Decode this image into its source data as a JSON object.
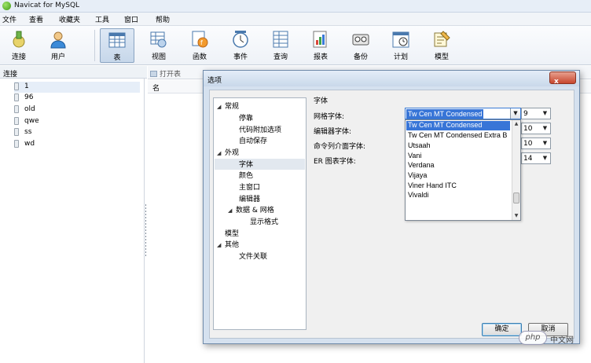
{
  "window": {
    "title": "Navicat for MySQL"
  },
  "menu": [
    "文件",
    "查看",
    "收藏夹",
    "工具",
    "窗口",
    "帮助"
  ],
  "toolbar": {
    "items": [
      {
        "label": "连接",
        "icon": "connection-icon"
      },
      {
        "label": "用户",
        "icon": "user-icon"
      },
      {
        "label": "表",
        "icon": "table-icon",
        "active": true
      },
      {
        "label": "视图",
        "icon": "view-icon"
      },
      {
        "label": "函数",
        "icon": "function-icon"
      },
      {
        "label": "事件",
        "icon": "event-icon"
      },
      {
        "label": "查询",
        "icon": "query-icon"
      },
      {
        "label": "报表",
        "icon": "report-icon"
      },
      {
        "label": "备份",
        "icon": "backup-icon"
      },
      {
        "label": "计划",
        "icon": "schedule-icon"
      },
      {
        "label": "模型",
        "icon": "model-icon"
      }
    ]
  },
  "left_pane": {
    "header": "连接",
    "databases": [
      "1",
      "96",
      "old",
      "qwe",
      "ss",
      "wd"
    ]
  },
  "object_pane": {
    "open_table": "打开表",
    "column_name": "名"
  },
  "dialog": {
    "title": "选项",
    "close": "x",
    "tree": [
      {
        "label": "常规",
        "level": 0,
        "expanded": true
      },
      {
        "label": "停靠",
        "level": 1
      },
      {
        "label": "代码附加选项",
        "level": 1
      },
      {
        "label": "自动保存",
        "level": 1
      },
      {
        "label": "外观",
        "level": 0,
        "expanded": true
      },
      {
        "label": "字体",
        "level": 1,
        "selected": true
      },
      {
        "label": "颜色",
        "level": 1
      },
      {
        "label": "主窗口",
        "level": 1
      },
      {
        "label": "编辑器",
        "level": 1
      },
      {
        "label": "数据 & 网格",
        "level": 1,
        "expanded": true
      },
      {
        "label": "显示格式",
        "level": 2
      },
      {
        "label": "模型",
        "level": 0
      },
      {
        "label": "其他",
        "level": 0,
        "expanded": true
      },
      {
        "label": "文件关联",
        "level": 1
      }
    ],
    "section_title": "字体",
    "fields": [
      {
        "label": "网格字体:",
        "size": "9"
      },
      {
        "label": "编辑器字体:",
        "size": "10"
      },
      {
        "label": "命令列介面字体:",
        "size": "10"
      },
      {
        "label": "ER 图表字体:",
        "size": "14"
      }
    ],
    "font_combo_value": "Tw Cen MT Condensed",
    "dropdown_options": [
      "Tw Cen MT Condensed",
      "Tw Cen MT Condensed Extra B",
      "Utsaah",
      "Vani",
      "Verdana",
      "Vijaya",
      "Viner Hand ITC",
      "Vivaldi"
    ],
    "dropdown_selected_index": 0,
    "ok": "确定",
    "cancel": "取消"
  },
  "watermark": {
    "badge": "php",
    "site": "中文网"
  },
  "colors": {
    "selection": "#3875d7",
    "dialog_frame": "#d5e1ef",
    "close_button": "#c7462e"
  }
}
